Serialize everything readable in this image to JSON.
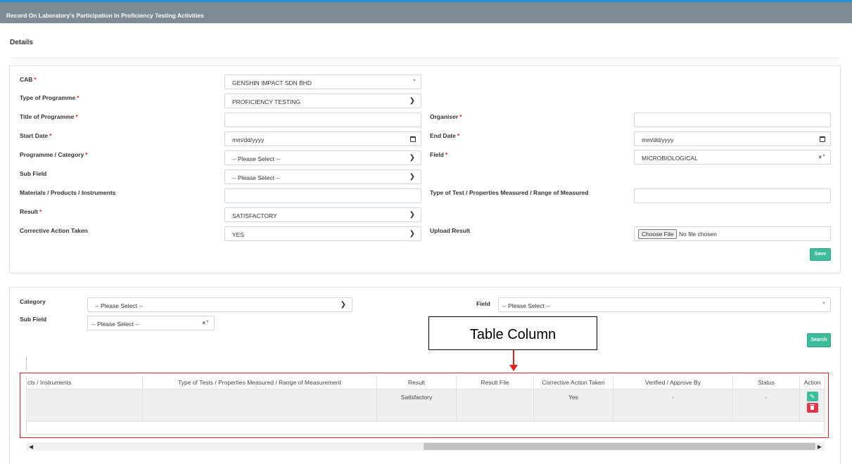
{
  "header": {
    "title": "Record On Laboratory's Participation In Proficiency Testing Activities"
  },
  "section": {
    "title": "Details"
  },
  "form": {
    "cab": {
      "label": "CAB",
      "value": "GENSHIN IMPACT SDN BHD"
    },
    "type_of_programme": {
      "label": "Type of Programme",
      "value": "PROFICIENCY TESTING"
    },
    "title_of_programme": {
      "label": "Title of Programme",
      "value": ""
    },
    "organiser": {
      "label": "Organiser",
      "value": ""
    },
    "start_date": {
      "label": "Start Date",
      "placeholder": "mm/dd/yyyy"
    },
    "end_date": {
      "label": "End Date",
      "placeholder": "mm/dd/yyyy"
    },
    "programme_category": {
      "label": "Programme / Category",
      "value": "-- Please Select --"
    },
    "field": {
      "label": "Field",
      "value": "MICROBIOLOGICAL"
    },
    "sub_field": {
      "label": "Sub Field",
      "value": "-- Please Select --"
    },
    "materials": {
      "label": "Materials / Products / Instruments",
      "value": ""
    },
    "type_of_test": {
      "label": "Type of Test / Properties Measured / Range of Measured",
      "value": ""
    },
    "result": {
      "label": "Result",
      "value": "SATISFACTORY"
    },
    "corrective_action": {
      "label": "Corrective Action Taken",
      "value": "YES"
    },
    "upload_result": {
      "label": "Upload Result",
      "button": "Choose File",
      "status": "No file chosen"
    },
    "required_mark": "*",
    "save_label": "Save"
  },
  "filter": {
    "category": {
      "label": "Category",
      "value": "-- Please Select --"
    },
    "field": {
      "label": "Field",
      "value": "-- Please Select --"
    },
    "sub_field": {
      "label": "Sub Field",
      "value": "-- Please Select --"
    },
    "search_label": "Search"
  },
  "annotation": {
    "text": "Table Column",
    "color": "#e02020"
  },
  "table": {
    "headers": [
      "cts / Instruments",
      "Type of Tests / Properties Measured / Range of Measurement",
      "Result",
      "Result File",
      "Corrective Action Taken",
      "Verified / Approve By",
      "Status",
      "Action"
    ],
    "rows": [
      {
        "instruments": "",
        "type_of_tests": "",
        "result": "Satisfactory",
        "result_file": "",
        "corrective_action": "Yes",
        "verified_by": "-",
        "status": "-"
      }
    ]
  },
  "colors": {
    "accent_green": "#3dbd9b",
    "delete_red": "#e8334a",
    "header_bar": "#7d8b95",
    "header_top_border": "#2c8fd8"
  }
}
